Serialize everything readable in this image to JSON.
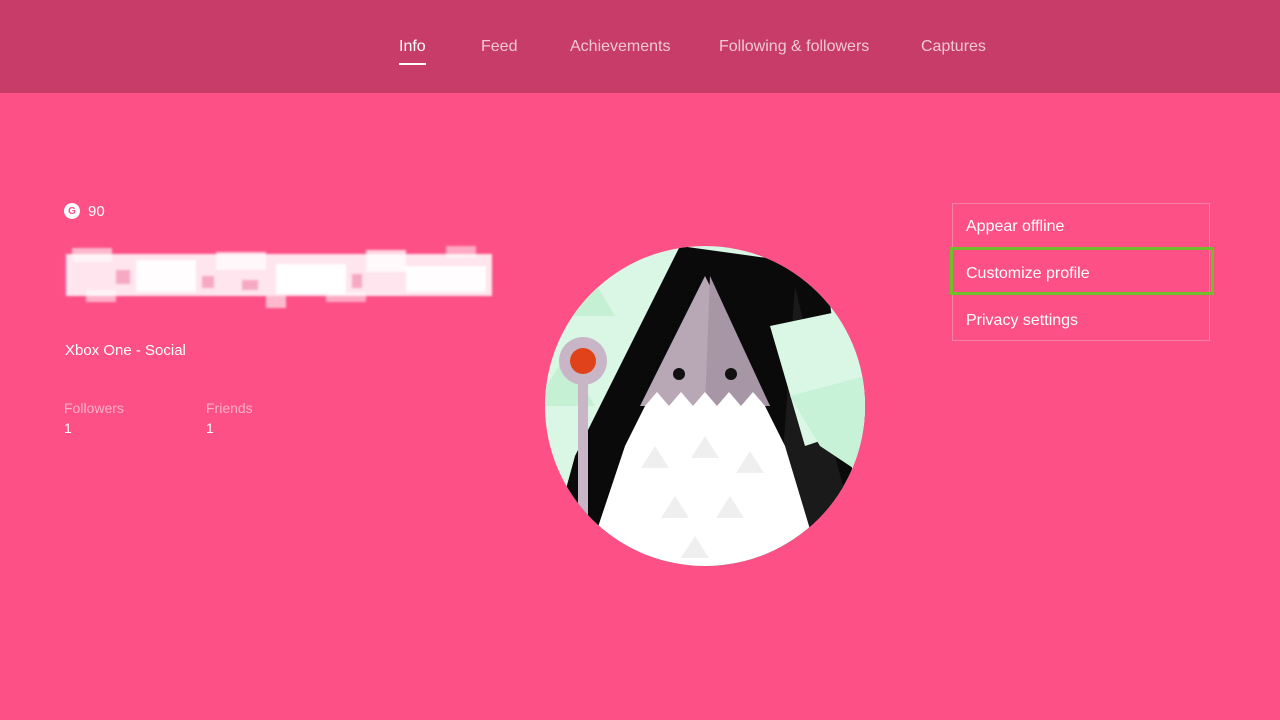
{
  "tabs": [
    {
      "label": "Info",
      "active": true
    },
    {
      "label": "Feed",
      "active": false
    },
    {
      "label": "Achievements",
      "active": false
    },
    {
      "label": "Following & followers",
      "active": false
    },
    {
      "label": "Captures",
      "active": false
    }
  ],
  "profile": {
    "gamerscore_icon": "G",
    "gamerscore": "90",
    "presence": "Xbox One - Social",
    "stats": [
      {
        "label": "Followers",
        "value": "1"
      },
      {
        "label": "Friends",
        "value": "1"
      }
    ]
  },
  "menu": {
    "items": [
      {
        "label": "Appear offline"
      },
      {
        "label": "Customize profile",
        "highlighted": true
      },
      {
        "label": "Privacy settings"
      }
    ]
  },
  "colors": {
    "background": "#fd5087",
    "topbar": "#c83c6a",
    "highlight": "#6fbf2a",
    "avatar_mint": "#d9f7e4",
    "avatar_gray": "#b8a8b6",
    "avatar_orange": "#e0421a"
  },
  "icons": {
    "gamerscore": "gamerscore-g-icon",
    "avatar": "wizard-avatar-image"
  }
}
